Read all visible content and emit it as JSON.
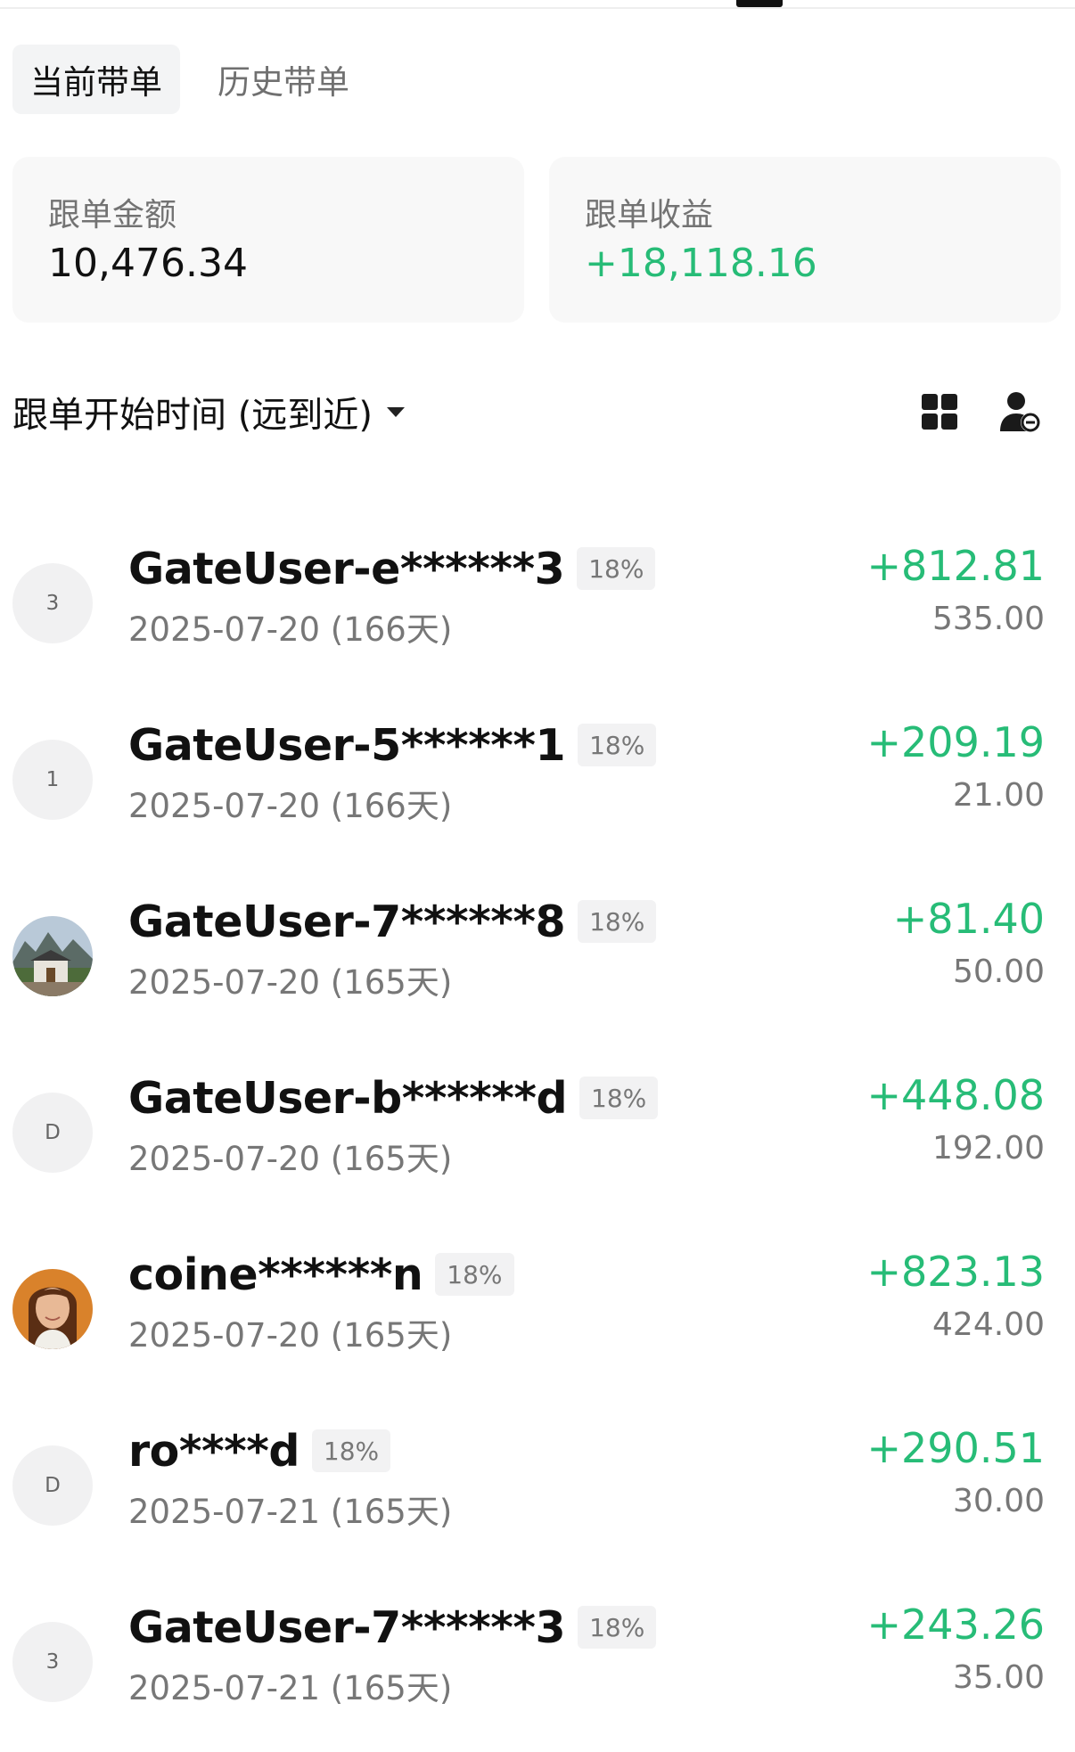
{
  "tabs": {
    "current": "当前带单",
    "history": "历史带单"
  },
  "summary": {
    "amount_label": "跟单金额",
    "amount_value": "10,476.34",
    "profit_label": "跟单收益",
    "profit_value": "+18,118.16"
  },
  "sort": {
    "label": "跟单开始时间 (远到近)"
  },
  "icons": {
    "grid": "grid-icon",
    "user": "user-remove-icon",
    "caret": "caret-down-icon"
  },
  "colors": {
    "profit_green": "#27bc77",
    "muted_text": "#777777",
    "avatar_bg": "#f1f1f2"
  },
  "followers": [
    {
      "avatar": "3",
      "name": "GateUser-e******3",
      "rate": "18%",
      "date": "2025-07-20 (166天)",
      "profit": "+812.81",
      "amount": "535.00"
    },
    {
      "avatar": "1",
      "name": "GateUser-5******1",
      "rate": "18%",
      "date": "2025-07-20 (166天)",
      "profit": "+209.19",
      "amount": "21.00"
    },
    {
      "avatar": "",
      "name": "GateUser-7******8",
      "rate": "18%",
      "date": "2025-07-20 (165天)",
      "profit": "+81.40",
      "amount": "50.00"
    },
    {
      "avatar": "D",
      "name": "GateUser-b******d",
      "rate": "18%",
      "date": "2025-07-20 (165天)",
      "profit": "+448.08",
      "amount": "192.00"
    },
    {
      "avatar": "",
      "name": "coine******n",
      "rate": "18%",
      "date": "2025-07-20 (165天)",
      "profit": "+823.13",
      "amount": "424.00"
    },
    {
      "avatar": "D",
      "name": "ro****d",
      "rate": "18%",
      "date": "2025-07-21 (165天)",
      "profit": "+290.51",
      "amount": "30.00"
    },
    {
      "avatar": "3",
      "name": "GateUser-7******3",
      "rate": "18%",
      "date": "2025-07-21 (165天)",
      "profit": "+243.26",
      "amount": "35.00"
    }
  ]
}
